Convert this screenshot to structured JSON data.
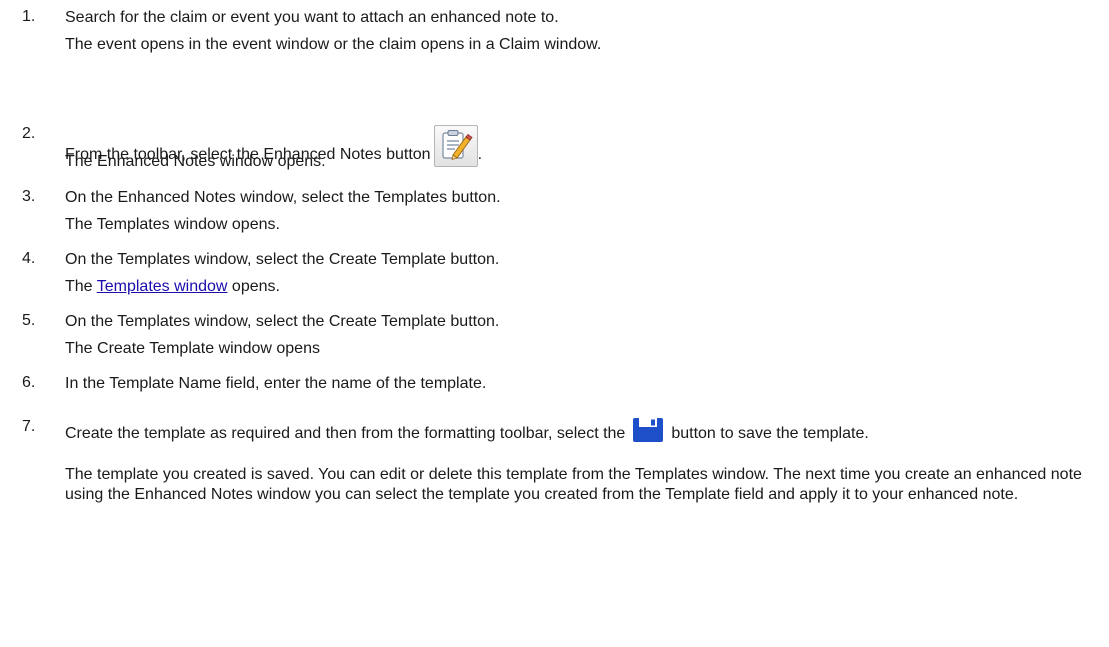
{
  "steps": [
    {
      "num": "1.",
      "text": "Search for the claim or event you want to attach an enhanced note to.",
      "result": "The event opens in the event window or the claim opens in a Claim window."
    },
    {
      "num": "2.",
      "text_before": " From the toolbar, select the Enhanced Notes button",
      "text_after": ".",
      "result": "The Enhanced Notes window opens."
    },
    {
      "num": "3.",
      "text": "On the Enhanced Notes window, select the Templates button.",
      "result": "The  Templates window opens."
    },
    {
      "num": "4.",
      "text": "On the Templates window, select the Create Template button.",
      "result_before": "The ",
      "result_link": "Templates window",
      "result_after": " opens."
    },
    {
      "num": "5.",
      "text": "On the Templates window, select the Create Template button.",
      "result": "The  Create Template window opens"
    },
    {
      "num": "6.",
      "text": "In the Template Name field, enter the name of the template."
    },
    {
      "num": "7.",
      "text_before": "Create the template as required and then from the formatting toolbar, select the",
      "text_after": "button to save the template.",
      "result": "The  template you created is saved. You can edit or delete this template from the Templates window. The next time you create an enhanced note using the Enhanced Notes  window you can select the template you created from the Template field and apply it to your enhanced note."
    }
  ],
  "icons": {
    "enhanced_notes": "enhanced-notes-icon",
    "save": "floppy-disk-icon"
  },
  "colors": {
    "link": "#1a0dab",
    "save_icon": "#1e4fc9"
  }
}
